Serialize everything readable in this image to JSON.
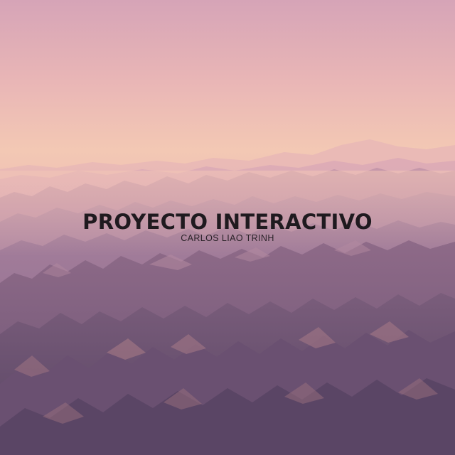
{
  "cover": {
    "title": "PROYECTO INTERACTIVO",
    "subtitle": "CARLOS LIAO TRINH"
  },
  "colors": {
    "sky_top": "#d7a8b6",
    "sky_mid": "#f0c3b2",
    "haze": "#f2c6b6",
    "mountain_far": "#c999ab",
    "mountain_mid": "#a47c98",
    "mountain_near": "#7b5f7c",
    "mountain_front": "#5e4866",
    "text": "#1f1a1f"
  }
}
